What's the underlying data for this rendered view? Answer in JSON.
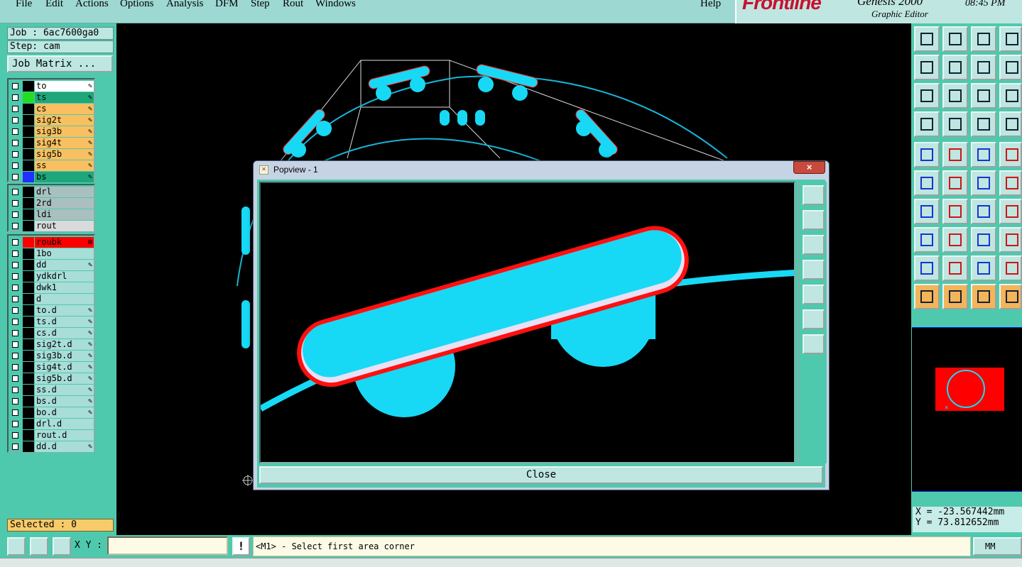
{
  "menu": [
    "File",
    "Edit",
    "Actions",
    "Options",
    "Analysis",
    "DFM",
    "Step",
    "Rout",
    "Windows"
  ],
  "help": "Help",
  "brand": {
    "logo": "Frontline",
    "product": "Genesis 2000",
    "subtitle": "Graphic Editor",
    "time": "08:45 PM"
  },
  "job": {
    "job_label": "Job : 6ac7600ga0",
    "step_label": "Step: cam",
    "matrix_button": "Job Matrix ..."
  },
  "layers": {
    "board": [
      {
        "name": "to",
        "name_bg": "#ffffff",
        "swatch": "#000000",
        "mark": "✎"
      },
      {
        "name": "ts",
        "name_bg": "#1fa67a",
        "swatch": "#22dd22",
        "mark": "✎"
      },
      {
        "name": "cs",
        "name_bg": "#f8c060",
        "swatch": "#000000",
        "mark": "✎"
      },
      {
        "name": "sig2t",
        "name_bg": "#f8c060",
        "swatch": "#000000",
        "mark": "✎"
      },
      {
        "name": "sig3b",
        "name_bg": "#f8c060",
        "swatch": "#000000",
        "mark": "✎"
      },
      {
        "name": "sig4t",
        "name_bg": "#f8c060",
        "swatch": "#000000",
        "mark": "✎"
      },
      {
        "name": "sig5b",
        "name_bg": "#f8c060",
        "swatch": "#000000",
        "mark": "✎"
      },
      {
        "name": "ss",
        "name_bg": "#f8c060",
        "swatch": "#000000",
        "mark": "✎"
      },
      {
        "name": "bs",
        "name_bg": "#1fa67a",
        "swatch": "#2030ff",
        "mark": "✎"
      }
    ],
    "drill": [
      {
        "name": "drl",
        "name_bg": "#a9bfc0",
        "swatch": "#000000",
        "mark": ""
      },
      {
        "name": "2rd",
        "name_bg": "#a9bfc0",
        "swatch": "#000000",
        "mark": ""
      },
      {
        "name": "ldi",
        "name_bg": "#a9bfc0",
        "swatch": "#000000",
        "mark": ""
      },
      {
        "name": "rout",
        "name_bg": "#dadada",
        "swatch": "#000000",
        "mark": ""
      }
    ],
    "misc": [
      {
        "name": "roubk",
        "name_bg": "#ff0000",
        "swatch": "#ff0000",
        "mark": "⊞"
      },
      {
        "name": "1bo",
        "name_bg": "#a8ddd8",
        "swatch": "#000000",
        "mark": ""
      },
      {
        "name": "dd",
        "name_bg": "#a8ddd8",
        "swatch": "#000000",
        "mark": "✎"
      },
      {
        "name": "ydkdrl",
        "name_bg": "#a8ddd8",
        "swatch": "#000000",
        "mark": ""
      },
      {
        "name": "dwk1",
        "name_bg": "#a8ddd8",
        "swatch": "#000000",
        "mark": ""
      },
      {
        "name": "d",
        "name_bg": "#a8ddd8",
        "swatch": "#000000",
        "mark": ""
      },
      {
        "name": "to.d",
        "name_bg": "#a8ddd8",
        "swatch": "#000000",
        "mark": "✎"
      },
      {
        "name": "ts.d",
        "name_bg": "#a8ddd8",
        "swatch": "#000000",
        "mark": "✎"
      },
      {
        "name": "cs.d",
        "name_bg": "#a8ddd8",
        "swatch": "#000000",
        "mark": "✎"
      },
      {
        "name": "sig2t.d",
        "name_bg": "#a8ddd8",
        "swatch": "#000000",
        "mark": "✎"
      },
      {
        "name": "sig3b.d",
        "name_bg": "#a8ddd8",
        "swatch": "#000000",
        "mark": "✎"
      },
      {
        "name": "sig4t.d",
        "name_bg": "#a8ddd8",
        "swatch": "#000000",
        "mark": "✎"
      },
      {
        "name": "sig5b.d",
        "name_bg": "#a8ddd8",
        "swatch": "#000000",
        "mark": "✎"
      },
      {
        "name": "ss.d",
        "name_bg": "#a8ddd8",
        "swatch": "#000000",
        "mark": "✎"
      },
      {
        "name": "bs.d",
        "name_bg": "#a8ddd8",
        "swatch": "#000000",
        "mark": "✎"
      },
      {
        "name": "bo.d",
        "name_bg": "#a8ddd8",
        "swatch": "#000000",
        "mark": "✎"
      },
      {
        "name": "drl.d",
        "name_bg": "#a8ddd8",
        "swatch": "#000000",
        "mark": ""
      },
      {
        "name": "rout.d",
        "name_bg": "#a8ddd8",
        "swatch": "#000000",
        "mark": ""
      },
      {
        "name": "dd.d",
        "name_bg": "#a8ddd8",
        "swatch": "#000000",
        "mark": "✎"
      }
    ]
  },
  "selected": "Selected : 0",
  "popview": {
    "title": "Popview - 1",
    "close_x": "×",
    "close_button": "Close"
  },
  "coords": {
    "x": "X = -23.567442mm",
    "y": "Y = 73.812652mm"
  },
  "bottom": {
    "xy_label": "X Y :",
    "status": "<M1> - Select first area corner",
    "units": "MM",
    "excl": "!"
  },
  "colors": {
    "pad": "#17d9f5",
    "outline_red": "#ff1010",
    "outline_white": "#e8e0f5",
    "panel": "#4fc9ad"
  },
  "tool_icons": [
    "zoom-home-icon",
    "zoom-fit-icon",
    "home-icon",
    "grid-icon",
    "pan-left-icon",
    "pan-right-icon",
    "undo-zoom-icon",
    "snap-icon",
    "fit-screen-icon",
    "zoom-center-icon",
    "ratio-icon",
    "help-icon",
    "measure-icon",
    "probe-icon",
    "net-icon",
    "net2-icon",
    "pad-icon",
    "select-icon",
    "ruler-icon",
    "dot-icon",
    "nodes-icon",
    "cross-icon",
    "move-icon",
    "copy-icon",
    "angle-icon",
    "line-icon",
    "rotate-icon",
    "mirror-icon",
    "feature-icon",
    "connect-icon",
    "distance-icon",
    "cluster-icon",
    "triangle-icon",
    "text-a-icon",
    "text-a2-icon",
    "text-a3-icon",
    "pointer-icon",
    "pointer2-icon",
    "pointer3-icon",
    "route-icon"
  ]
}
